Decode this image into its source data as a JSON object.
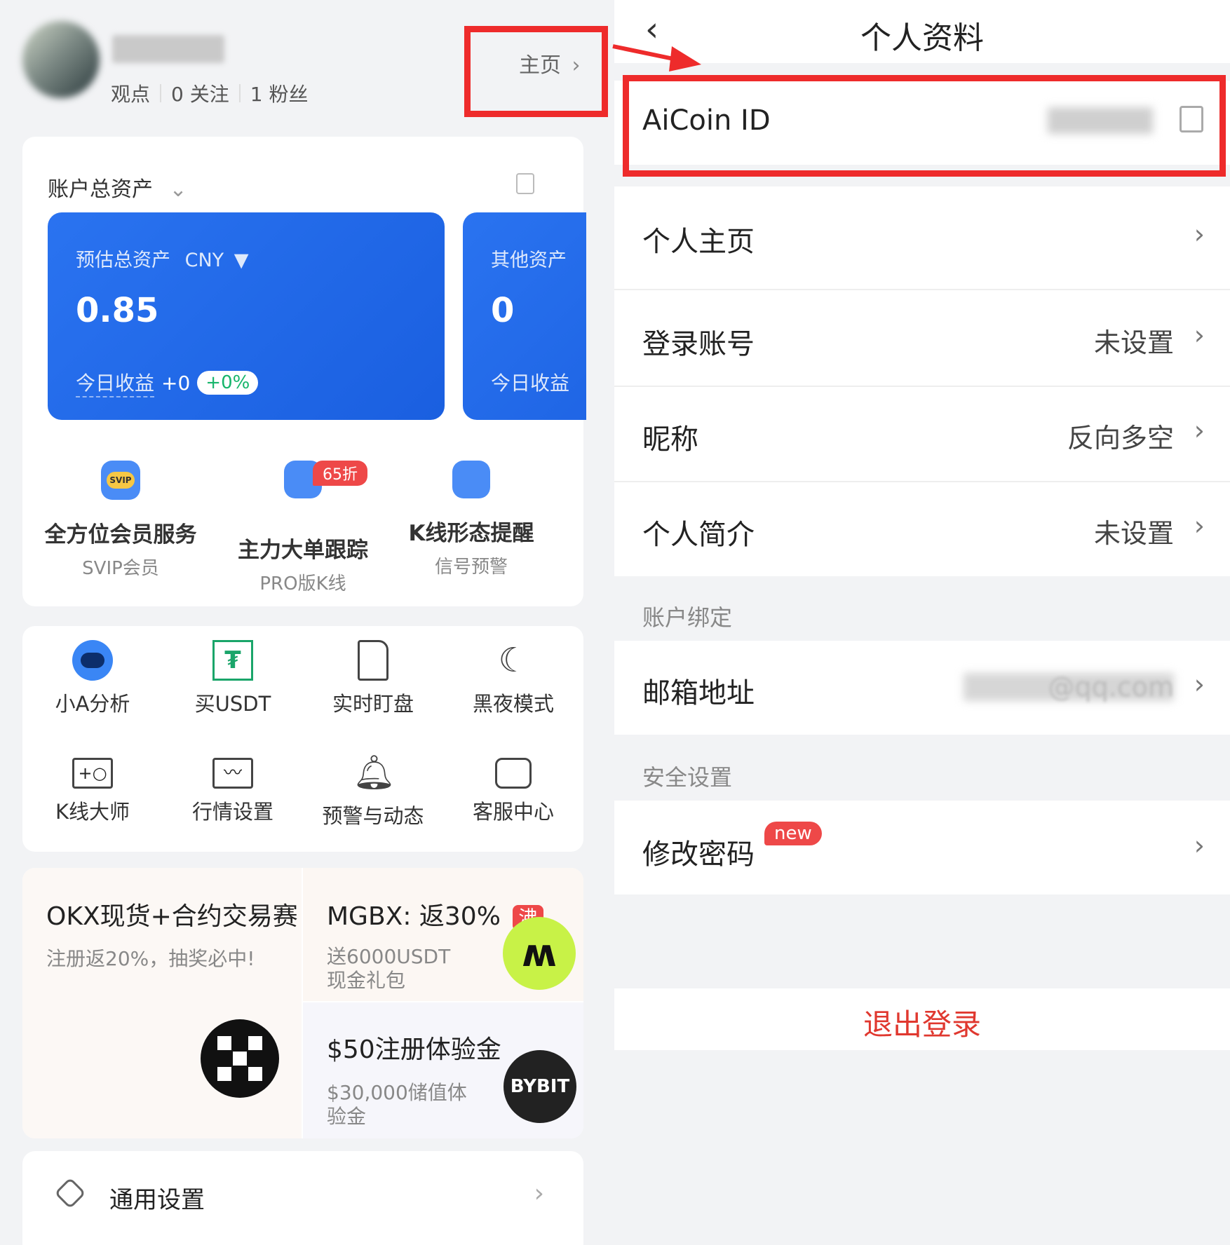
{
  "left": {
    "profile": {
      "stats": [
        "观点",
        "0 关注",
        "1 粉丝"
      ],
      "home_link": "主页"
    },
    "assets": {
      "section_title": "账户总资产",
      "card1": {
        "label": "预估总资产",
        "currency": "CNY",
        "value": "0.85",
        "today_label": "今日收益",
        "today_value": "+0",
        "today_percent": "+0%"
      },
      "card2": {
        "label": "其他资产",
        "value": "0",
        "today_label": "今日收益"
      }
    },
    "features": [
      {
        "title": "全方位会员服务",
        "sub": "SVIP会员",
        "icon_text": "SVIP"
      },
      {
        "title": "主力大单跟踪",
        "sub": "PRO版K线",
        "badge": "65折"
      },
      {
        "title": "K线形态提醒",
        "sub": "信号预警"
      }
    ],
    "tools": [
      {
        "label": "小A分析",
        "icon": "robot-icon"
      },
      {
        "label": "买USDT",
        "icon": "usdt-icon"
      },
      {
        "label": "实时盯盘",
        "icon": "document-icon"
      },
      {
        "label": "黑夜模式",
        "icon": "moon-icon"
      },
      {
        "label": "K线大师",
        "icon": "kline-master-icon"
      },
      {
        "label": "行情设置",
        "icon": "chart-settings-icon"
      },
      {
        "label": "预警与动态",
        "icon": "bell-icon"
      },
      {
        "label": "客服中心",
        "icon": "service-icon"
      }
    ],
    "promos": [
      {
        "title": "OKX现货+合约交易赛",
        "sub": "注册返20%，抽奖必中!"
      },
      {
        "title": "MGBX: 返30%",
        "badge": "沸",
        "sub": "送6000USDT现金礼包"
      },
      {
        "title": "$50注册体验金",
        "sub": "$30,000储值体验金",
        "logo_text": "BYBIT"
      }
    ],
    "general_settings": "通用设置"
  },
  "right": {
    "title": "个人资料",
    "id_label": "AiCoin ID",
    "rows": [
      {
        "label": "个人主页",
        "value": ""
      },
      {
        "label": "登录账号",
        "value": "未设置"
      },
      {
        "label": "昵称",
        "value": "反向多空"
      },
      {
        "label": "个人简介",
        "value": "未设置"
      }
    ],
    "section_binding": "账户绑定",
    "email_label": "邮箱地址",
    "email_value": "@qq.com",
    "section_security": "安全设置",
    "password_label": "修改密码",
    "password_badge": "new",
    "logout": "退出登录"
  },
  "colors": {
    "accent_blue": "#1a64ee",
    "highlight_red": "#ee2b2b",
    "logout_red": "#e0382f",
    "badge_red": "#ee4848"
  }
}
